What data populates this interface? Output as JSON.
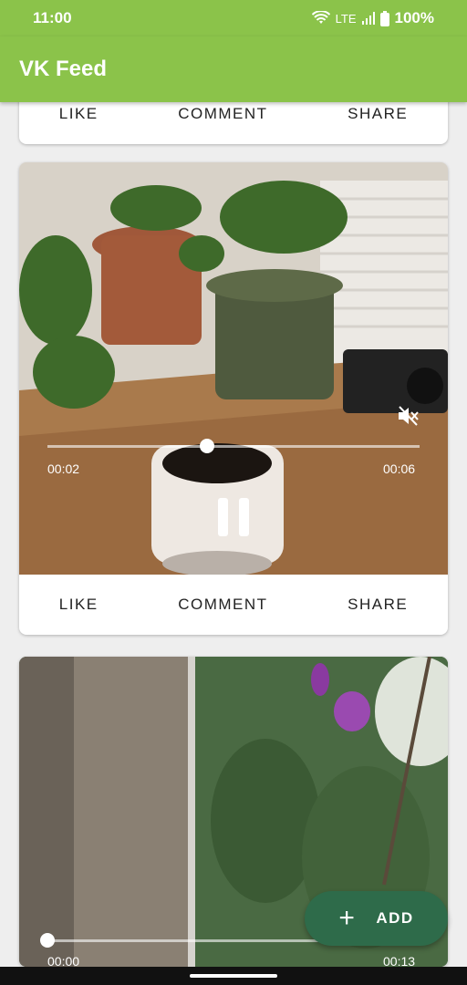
{
  "status_bar": {
    "time": "11:00",
    "network": "LTE",
    "battery": "100%"
  },
  "app_bar": {
    "title": "VK Feed"
  },
  "actions": {
    "like": "LIKE",
    "comment": "COMMENT",
    "share": "SHARE"
  },
  "posts": [
    {
      "video": {
        "elapsed": "00:02",
        "duration": "00:06",
        "progress": 0.43,
        "muted": true,
        "state": "playing"
      }
    },
    {
      "video": {
        "elapsed": "00:00",
        "duration": "00:13",
        "progress": 0.0
      }
    }
  ],
  "fab": {
    "label": "ADD",
    "icon": "plus-icon"
  },
  "colors": {
    "primary": "#8bc34a",
    "fab": "#2e6b4a"
  }
}
